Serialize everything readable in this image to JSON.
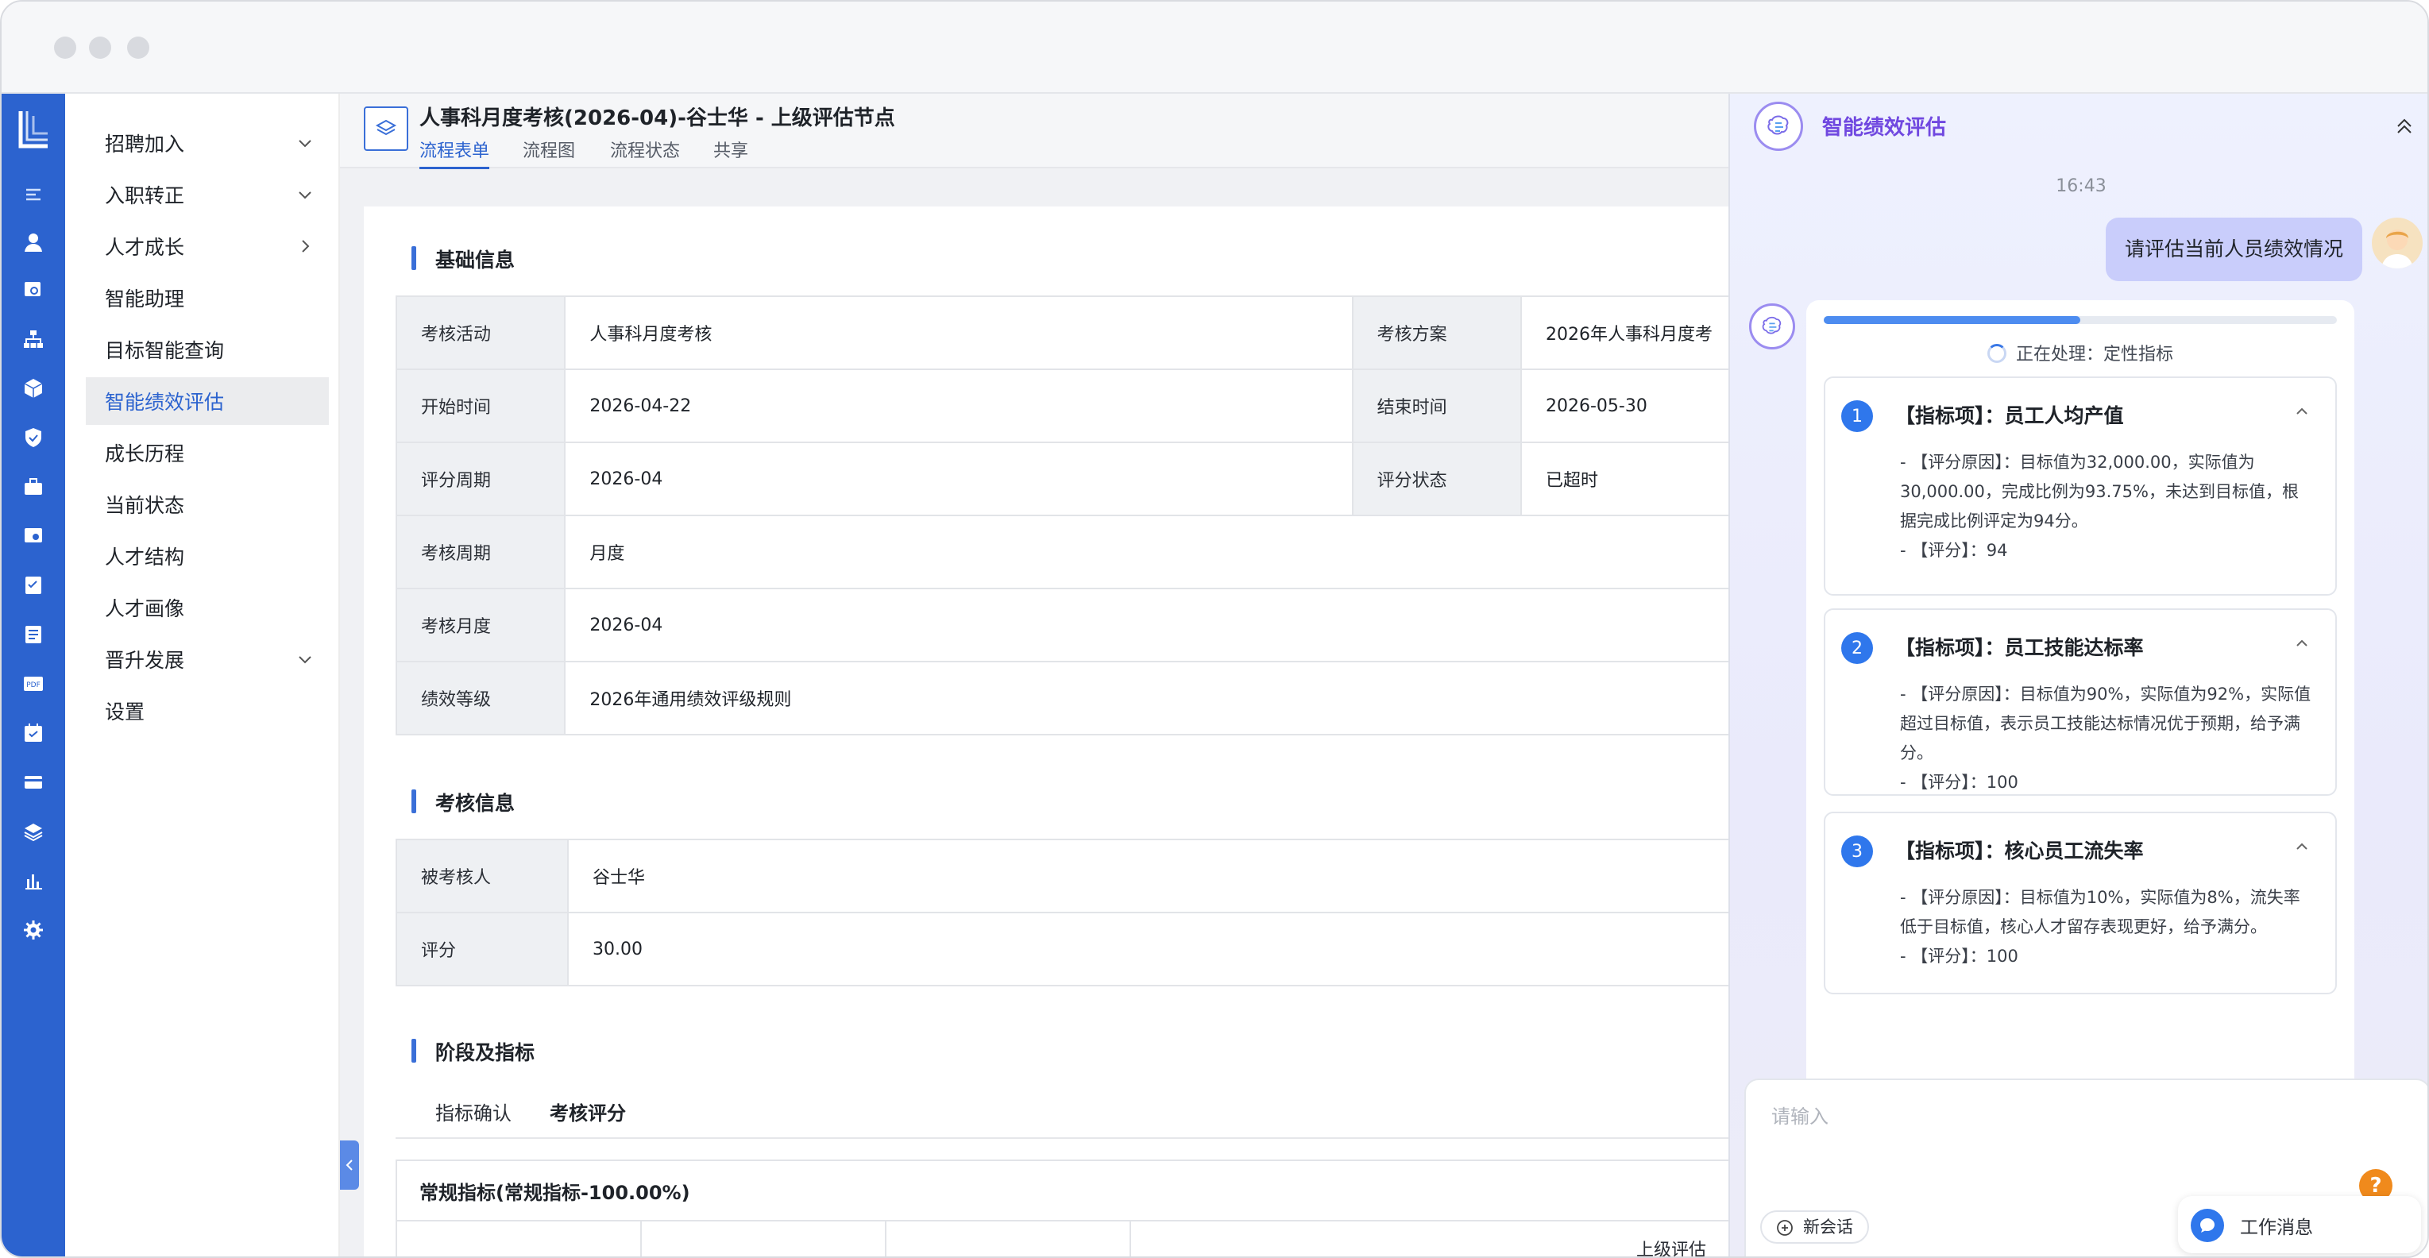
{
  "window": {
    "dots": [
      "close",
      "minimize",
      "maximize"
    ]
  },
  "menu": {
    "items": [
      {
        "label": "招聘加入",
        "chevron": "down"
      },
      {
        "label": "入职转正",
        "chevron": "down"
      },
      {
        "label": "人才成长",
        "chevron": "right"
      },
      {
        "label": "智能助理",
        "chevron": ""
      },
      {
        "label": "目标智能查询",
        "chevron": ""
      },
      {
        "label": "智能绩效评估",
        "chevron": "",
        "active": true
      },
      {
        "label": "成长历程",
        "chevron": ""
      },
      {
        "label": "当前状态",
        "chevron": ""
      },
      {
        "label": "人才结构",
        "chevron": ""
      },
      {
        "label": "人才画像",
        "chevron": ""
      },
      {
        "label": "晋升发展",
        "chevron": "down"
      },
      {
        "label": "设置",
        "chevron": ""
      }
    ]
  },
  "header": {
    "title": "人事科月度考核(2026-04)-谷士华 - 上级评估节点",
    "tabs": [
      "流程表单",
      "流程图",
      "流程状态",
      "共享"
    ]
  },
  "form": {
    "basic_title": "基础信息",
    "basic": {
      "activity_label": "考核活动",
      "activity_value": "人事科月度考核",
      "plan_label": "考核方案",
      "plan_value": "2026年人事科月度考",
      "start_label": "开始时间",
      "start_value": "2026-04-22",
      "end_label": "结束时间",
      "end_value": "2026-05-30",
      "period_label": "评分周期",
      "period_value": "2026-04",
      "status_label": "评分状态",
      "status_value": "已超时",
      "cycle_label": "考核周期",
      "cycle_value": "月度",
      "month_label": "考核月度",
      "month_value": "2026-04",
      "grade_label": "绩效等级",
      "grade_value": "2026年通用绩效评级规则"
    },
    "review_title": "考核信息",
    "review": {
      "person_label": "被考核人",
      "person_value": "谷士华",
      "score_label": "评分",
      "score_value": "30.00"
    },
    "stage_title": "阶段及指标",
    "stage_tabs": [
      "指标确认",
      "考核评分"
    ],
    "regular_title": "常规指标(常规指标-100.00%)",
    "col_partial": "上级评估"
  },
  "panel": {
    "title": "智能绩效评估",
    "time": "16:43",
    "user_message": "请评估当前人员绩效情况",
    "progress": 0.5,
    "processing": "正在处理：定性指标",
    "items": [
      {
        "num": "1",
        "title": "【指标项】：员工人均产值",
        "reason": "- 【评分原因】：目标值为32,000.00，实际值为30,000.00，完成比例为93.75%，未达到目标值，根据完成比例评定为94分。",
        "score": "- 【评分】：94"
      },
      {
        "num": "2",
        "title": "【指标项】：员工技能达标率",
        "reason": "- 【评分原因】：目标值为90%，实际值为92%，实际值超过目标值，表示员工技能达标情况优于预期，给予满分。",
        "score": "- 【评分】：100"
      },
      {
        "num": "3",
        "title": "【指标项】：核心员工流失率",
        "reason": "- 【评分原因】：目标值为10%，实际值为8%，流失率低于目标值，核心人才留存表现更好，给予满分。",
        "score": "- 【评分】：100"
      }
    ],
    "input_placeholder": "请输入",
    "new_chat": "新会话",
    "help": "?",
    "work_message": "工作消息"
  }
}
